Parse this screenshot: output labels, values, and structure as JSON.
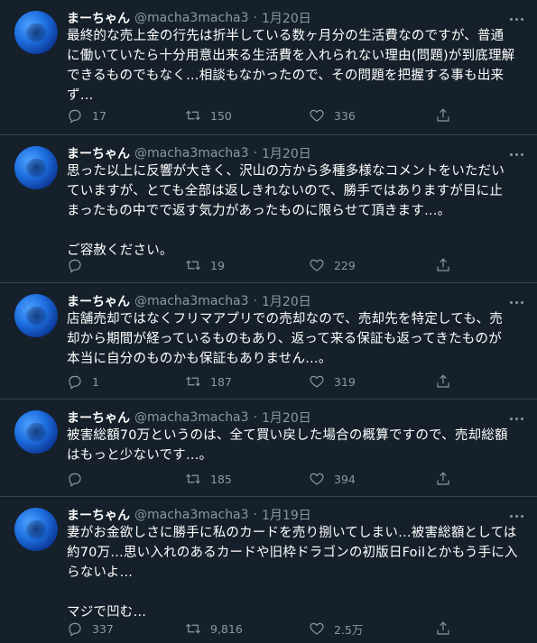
{
  "tweets": [
    {
      "name": "まーちゃん",
      "handle": "@macha3macha3",
      "sep": "·",
      "date": "1月20日",
      "text": "最終的な売上金の行先は折半している数ヶ月分の生活費なのですが、普通\nに働いていたら十分用意出来る生活費を入れられない理由(問題)が到底理解\nできるものでもなく…相談もなかったので、その問題を把握する事も出来\nず…",
      "replies": "17",
      "retweets": "150",
      "likes": "336"
    },
    {
      "name": "まーちゃん",
      "handle": "@macha3macha3",
      "sep": "·",
      "date": "1月20日",
      "text": "思った以上に反響が大きく、沢山の方から多種多様なコメントをいただい\nていますが、とても全部は返しきれないので、勝手ではありますが目に止\nまったもの中でで返す気力があったものに限らせて頂きます…。\n\nご容赦ください。",
      "replies": "",
      "retweets": "19",
      "likes": "229"
    },
    {
      "name": "まーちゃん",
      "handle": "@macha3macha3",
      "sep": "·",
      "date": "1月20日",
      "text": "店舗売却ではなくフリマアプリでの売却なので、売却先を特定しても、売\n却から期間が経っているものもあり、返って来る保証も返ってきたものが\n本当に自分のものかも保証もありません…。",
      "replies": "1",
      "retweets": "187",
      "likes": "319"
    },
    {
      "name": "まーちゃん",
      "handle": "@macha3macha3",
      "sep": "·",
      "date": "1月20日",
      "text": "被害総額70万というのは、全て買い戻した場合の概算ですので、売却総額\nはもっと少ないです…。",
      "replies": "",
      "retweets": "185",
      "likes": "394"
    },
    {
      "name": "まーちゃん",
      "handle": "@macha3macha3",
      "sep": "·",
      "date": "1月19日",
      "text": "妻がお金欲しさに勝手に私のカードを売り捌いてしまい…被害総額としては\n約70万…思い入れのあるカードや旧枠ドラゴンの初版日Foilとかもう手に入\nらないよ…\n\nマジで凹む…",
      "replies": "337",
      "retweets": "9,816",
      "likes": "2.5万"
    }
  ]
}
